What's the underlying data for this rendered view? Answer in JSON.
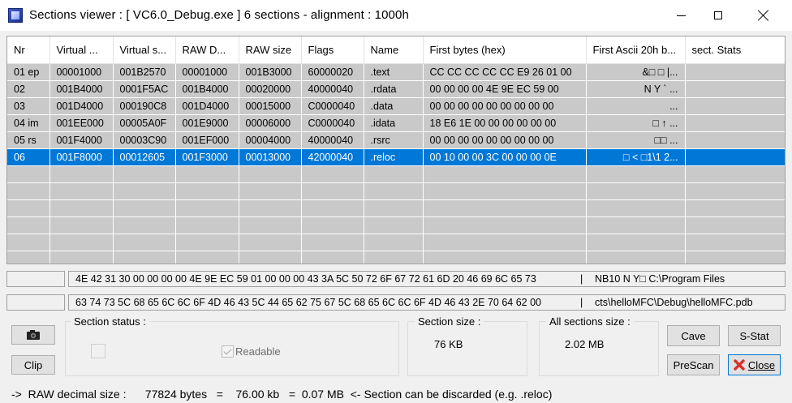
{
  "window": {
    "title": "Sections viewer :  [ VC6.0_Debug.exe ] 6 sections - alignment : 1000h"
  },
  "table": {
    "columns": [
      "Nr",
      "Virtual ...",
      "Virtual s...",
      "RAW D...",
      "RAW size",
      "Flags",
      "Name",
      "First bytes (hex)",
      "First Ascii 20h b...",
      "sect. Stats"
    ],
    "rows": [
      [
        "01 ep",
        "00001000",
        "001B2570",
        "00001000",
        "001B3000",
        "60000020",
        ".text",
        "CC CC CC CC CC E9 26 01 00",
        "&□   □  |...",
        ""
      ],
      [
        "02",
        "001B4000",
        "0001F5AC",
        "001B4000",
        "00020000",
        "40000040",
        ".rdata",
        "00 00 00 00 4E 9E EC 59 00",
        "N Y       `   ...",
        ""
      ],
      [
        "03",
        "001D4000",
        "000190C8",
        "001D4000",
        "00015000",
        "C0000040",
        ".data",
        "00 00 00 00 00 00 00 00 00",
        "...",
        ""
      ],
      [
        "04 im",
        "001EE000",
        "00005A0F",
        "001E9000",
        "00006000",
        "C0000040",
        ".idata",
        "18 E6 1E 00 00 00 00 00 00",
        "□          ↑      ...",
        ""
      ],
      [
        "05 rs",
        "001F4000",
        "00003C90",
        "001EF000",
        "00004000",
        "40000040",
        ".rsrc",
        "00 00 00 00 00 00 00 00 00",
        "□□ ...",
        ""
      ],
      [
        "06",
        "001F8000",
        "00012605",
        "001F3000",
        "00013000",
        "42000040",
        ".reloc",
        "00 10 00 00 3C 00 00 00 0E",
        "□ <  □1\\1 2...",
        ""
      ]
    ],
    "selected_row_index": 5
  },
  "hex_lines": [
    {
      "hex": "4E 42 31 30 00 00 00 00 4E 9E EC 59 01 00 00 00 43 3A 5C 50 72 6F 67 72 61 6D 20 46 69 6C 65 73",
      "sep": "|",
      "ascii": "NB10    N Y□   C:\\Program Files"
    },
    {
      "hex": "63 74 73 5C 68 65 6C 6C 6F 4D 46 43 5C 44 65 62 75 67 5C 68 65 6C 6C 6F 4D 46 43 2E 70 64 62 00",
      "sep": "|",
      "ascii": "cts\\helloMFC\\Debug\\helloMFC.pdb"
    }
  ],
  "section_status": {
    "label": "Section status :",
    "readable_label": "Readable"
  },
  "section_size": {
    "label": "Section size :",
    "value": "76 KB"
  },
  "all_sections_size": {
    "label": "All sections size :",
    "value": "2.02 MB"
  },
  "buttons": {
    "clip": "Clip",
    "cave": "Cave",
    "sstat": "S-Stat",
    "prescan": "PreScan",
    "close": "Close"
  },
  "status": {
    "text": "->  RAW decimal size :      77824 bytes   =    76.00 kb   =  0.07 MB  <- Section can be discarded (e.g. .reloc)"
  },
  "colors": {
    "selection": "#0078d7",
    "list_bg": "#c9c9c9",
    "window_bg": "#f0f0f0"
  },
  "icons": [
    "app-icon",
    "minimize-icon",
    "maximize-icon",
    "close-icon",
    "camera-icon",
    "red-x-icon"
  ]
}
